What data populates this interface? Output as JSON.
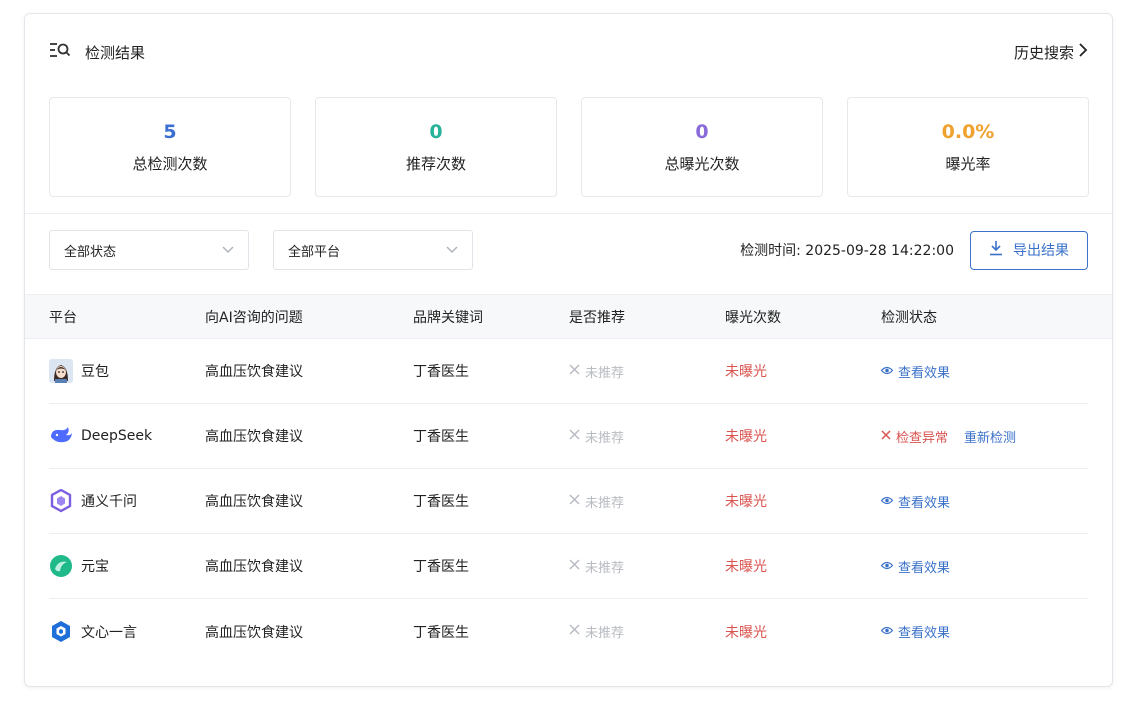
{
  "header": {
    "title": "检测结果",
    "history_label": "历史搜索"
  },
  "stats": [
    {
      "value": "5",
      "label": "总检测次数",
      "color": "#3b6fd1"
    },
    {
      "value": "0",
      "label": "推荐次数",
      "color": "#26b39a"
    },
    {
      "value": "0",
      "label": "总曝光次数",
      "color": "#8a6ad9"
    },
    {
      "value": "0.0%",
      "label": "曝光率",
      "color": "#efa22f"
    }
  ],
  "filters": {
    "status_select": "全部状态",
    "platform_select": "全部平台",
    "check_time": "检测时间: 2025-09-28 14:22:00",
    "export_label": "导出结果"
  },
  "table": {
    "columns": [
      "平台",
      "向AI咨询的问题",
      "品牌关键词",
      "是否推荐",
      "曝光次数",
      "检测状态"
    ],
    "rows": [
      {
        "platform": "豆包",
        "icon": "doubao-logo-icon",
        "question": "高血压饮食建议",
        "brand": "丁香医生",
        "recommended": "未推荐",
        "exposure": "未曝光",
        "status": "查看效果",
        "status_type": "view"
      },
      {
        "platform": "DeepSeek",
        "icon": "deepseek-logo-icon",
        "question": "高血压饮食建议",
        "brand": "丁香医生",
        "recommended": "未推荐",
        "exposure": "未曝光",
        "status": "检查异常",
        "status_type": "error",
        "retest": "重新检测"
      },
      {
        "platform": "通义千问",
        "icon": "tongyi-logo-icon",
        "question": "高血压饮食建议",
        "brand": "丁香医生",
        "recommended": "未推荐",
        "exposure": "未曝光",
        "status": "查看效果",
        "status_type": "view"
      },
      {
        "platform": "元宝",
        "icon": "yuanbao-logo-icon",
        "question": "高血压饮食建议",
        "brand": "丁香医生",
        "recommended": "未推荐",
        "exposure": "未曝光",
        "status": "查看效果",
        "status_type": "view"
      },
      {
        "platform": "文心一言",
        "icon": "wenxin-logo-icon",
        "question": "高血压饮食建议",
        "brand": "丁香医生",
        "recommended": "未推荐",
        "exposure": "未曝光",
        "status": "查看效果",
        "status_type": "view"
      }
    ]
  }
}
